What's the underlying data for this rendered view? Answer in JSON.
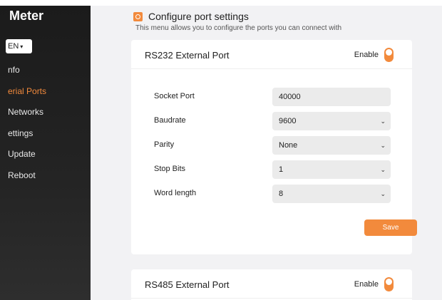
{
  "sidebar": {
    "brand": "Meter",
    "language": "EN",
    "items": [
      {
        "label": "Info",
        "display": "nfo",
        "active": false
      },
      {
        "label": "Serial Ports",
        "display": "erial Ports",
        "active": true
      },
      {
        "label": "Networks",
        "display": "Networks",
        "active": false
      },
      {
        "label": "Settings",
        "display": "ettings",
        "active": false
      },
      {
        "label": "Update",
        "display": "Update",
        "active": false
      },
      {
        "label": "Reboot",
        "display": "Reboot",
        "active": false
      }
    ]
  },
  "header": {
    "title": "Configure port settings",
    "subtitle": "This menu allows you to configure the ports you can connect with"
  },
  "rs232": {
    "title": "RS232 External Port",
    "enable_label": "Enable",
    "enabled": true,
    "fields": {
      "socket_port": {
        "label": "Socket Port",
        "value": "40000"
      },
      "baudrate": {
        "label": "Baudrate",
        "value": "9600"
      },
      "parity": {
        "label": "Parity",
        "value": "None"
      },
      "stop_bits": {
        "label": "Stop Bits",
        "value": "1"
      },
      "word_length": {
        "label": "Word length",
        "value": "8"
      }
    },
    "save_label": "Save"
  },
  "rs485": {
    "title": "RS485 External Port",
    "enable_label": "Enable",
    "enabled": true
  },
  "colors": {
    "accent": "#f28a3c",
    "sidebar_bg": "#1b1b1b",
    "content_bg": "#f2f2f4",
    "input_bg": "#ebebeb"
  },
  "icons": {
    "title_icon": "settings-gear-icon",
    "dropdown": "chevron-down-icon"
  }
}
